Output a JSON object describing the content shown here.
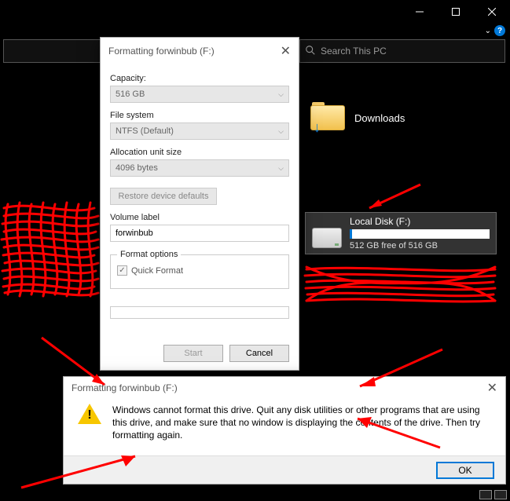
{
  "window": {
    "search_placeholder": "Search This PC"
  },
  "folder": {
    "downloads_label": "Downloads"
  },
  "disk": {
    "name": "Local Disk (F:)",
    "free_text": "512 GB free of 516 GB"
  },
  "dialog": {
    "title": "Formatting forwinbub (F:)",
    "capacity_label": "Capacity:",
    "capacity_value": "516 GB",
    "filesystem_label": "File system",
    "filesystem_value": "NTFS (Default)",
    "allocation_label": "Allocation unit size",
    "allocation_value": "4096 bytes",
    "restore_label": "Restore device defaults",
    "volume_label_label": "Volume label",
    "volume_label_value": "forwinbub",
    "format_options_legend": "Format options",
    "quick_format_label": "Quick Format",
    "start_label": "Start",
    "cancel_label": "Cancel"
  },
  "msgbox": {
    "title": "Formatting forwinbub (F:)",
    "text": "Windows cannot format this drive. Quit any disk utilities or other programs that are using this drive, and make sure that no window is displaying the contents of the drive. Then try formatting again.",
    "ok_label": "OK"
  }
}
